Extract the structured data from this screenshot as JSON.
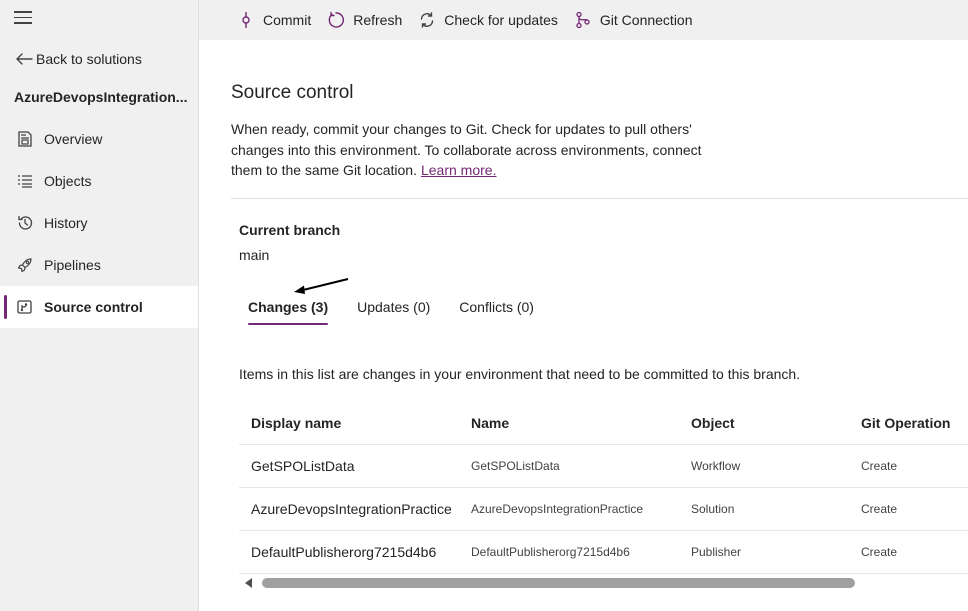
{
  "sidebar": {
    "back_label": "Back to solutions",
    "solution_name": "AzureDevopsIntegration...",
    "items": [
      {
        "label": "Overview",
        "icon": "overview-icon"
      },
      {
        "label": "Objects",
        "icon": "objects-list-icon"
      },
      {
        "label": "History",
        "icon": "history-icon"
      },
      {
        "label": "Pipelines",
        "icon": "rocket-icon"
      },
      {
        "label": "Source control",
        "icon": "source-control-icon",
        "active": true
      }
    ]
  },
  "toolbar": {
    "commit_label": "Commit",
    "refresh_label": "Refresh",
    "check_updates_label": "Check for updates",
    "git_connection_label": "Git Connection"
  },
  "main": {
    "title": "Source control",
    "description": "When ready, commit your changes to Git. Check for updates to pull others' changes into this environment. To collaborate across environments, connect them to the same Git location.",
    "learn_more": "Learn more.",
    "branch_label": "Current branch",
    "branch_value": "main",
    "tabs": [
      {
        "label": "Changes (3)",
        "active": true
      },
      {
        "label": "Updates (0)"
      },
      {
        "label": "Conflicts (0)"
      }
    ],
    "list_info": "Items in this list are changes in your environment that need to be committed to this branch.",
    "table": {
      "headers": [
        "Display name",
        "Name",
        "Object",
        "Git Operation"
      ],
      "rows": [
        [
          "GetSPOListData",
          "GetSPOListData",
          "Workflow",
          "Create"
        ],
        [
          "AzureDevopsIntegrationPractice",
          "AzureDevopsIntegrationPractice",
          "Solution",
          "Create"
        ],
        [
          "DefaultPublisherorg7215d4b6",
          "DefaultPublisherorg7215d4b6",
          "Publisher",
          "Create"
        ]
      ]
    }
  },
  "colors": {
    "accent": "#742774",
    "sidebar_bg": "#f0f0f0"
  }
}
